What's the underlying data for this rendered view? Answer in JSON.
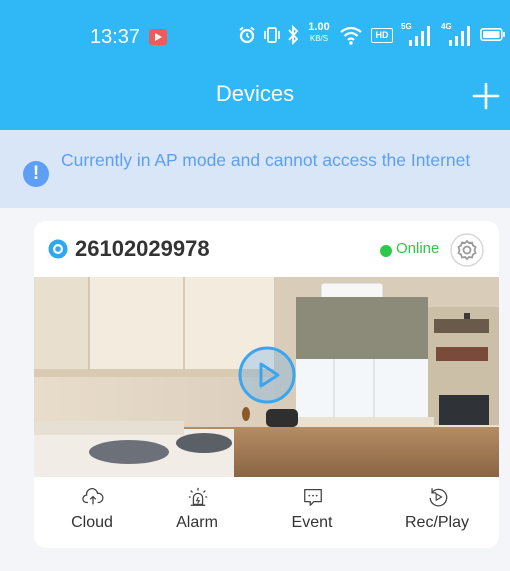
{
  "status_bar": {
    "time": "13:37",
    "net_speed_top": "1.00",
    "net_speed_bottom": "KB/S",
    "hd_label": "HD",
    "sim1_label": "5G",
    "sim2_label": "4G",
    "icons": [
      "alarm-clock-icon",
      "vibrate-icon",
      "bluetooth-icon",
      "wifi-icon",
      "signal-icon",
      "battery-icon"
    ]
  },
  "header": {
    "title": "Devices",
    "add_icon": "plus-icon"
  },
  "banner": {
    "icon": "!",
    "text": "Currently in AP mode and cannot access the Internet"
  },
  "device": {
    "id": "26102029978",
    "status": "Online",
    "status_color": "#2fc84a",
    "actions": [
      {
        "label": "Cloud",
        "icon": "cloud-upload-icon"
      },
      {
        "label": "Alarm",
        "icon": "alarm-siren-icon"
      },
      {
        "label": "Event",
        "icon": "event-message-icon"
      },
      {
        "label": "Rec/Play",
        "icon": "replay-icon"
      }
    ]
  },
  "colors": {
    "header": "#2fb8f5",
    "banner_bg": "#d9e6f7",
    "banner_text": "#5c9ff5",
    "page_bg": "#f4f5f8"
  }
}
